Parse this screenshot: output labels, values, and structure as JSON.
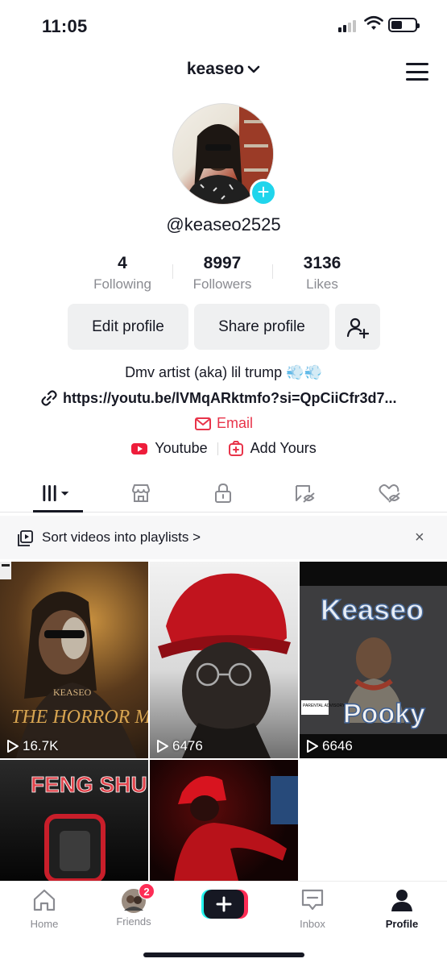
{
  "status_bar": {
    "time": "11:05"
  },
  "header": {
    "username": "keaseo"
  },
  "profile": {
    "handle": "@keaseo2525",
    "stats": [
      {
        "value": "4",
        "label": "Following"
      },
      {
        "value": "8997",
        "label": "Followers"
      },
      {
        "value": "3136",
        "label": "Likes"
      }
    ],
    "buttons": {
      "edit": "Edit profile",
      "share": "Share profile"
    },
    "bio": "Dmv artist (aka) lil trump 💨💨",
    "link": "https://youtu.be/lVMqARktmfo?si=QpCiiCfr3d7...",
    "email_label": "Email",
    "socials": {
      "youtube": "Youtube",
      "add_yours": "Add Yours"
    }
  },
  "tabs": [
    "videos-tab",
    "shop-tab",
    "private-tab",
    "reposts-tab",
    "liked-tab"
  ],
  "playlist_banner": {
    "text": "Sort videos into playlists >",
    "close": "×"
  },
  "videos": [
    {
      "views": "16.7K",
      "title": "THE HORROR MOVIE",
      "artist": "KEASEO"
    },
    {
      "views": "6476"
    },
    {
      "views": "6646",
      "title": "Pooky",
      "artist": "Keaseo",
      "badge": "PARENTAL ADVISORY"
    },
    {
      "title": "FENG SHUI"
    },
    {}
  ],
  "bottom_nav": {
    "items": [
      {
        "label": "Home"
      },
      {
        "label": "Friends",
        "badge": "2"
      },
      {
        "label": ""
      },
      {
        "label": "Inbox"
      },
      {
        "label": "Profile"
      }
    ]
  },
  "colors": {
    "accent_red": "#e8344a",
    "cyan": "#20d5ec",
    "text": "#161823",
    "muted": "#8a8b91"
  }
}
